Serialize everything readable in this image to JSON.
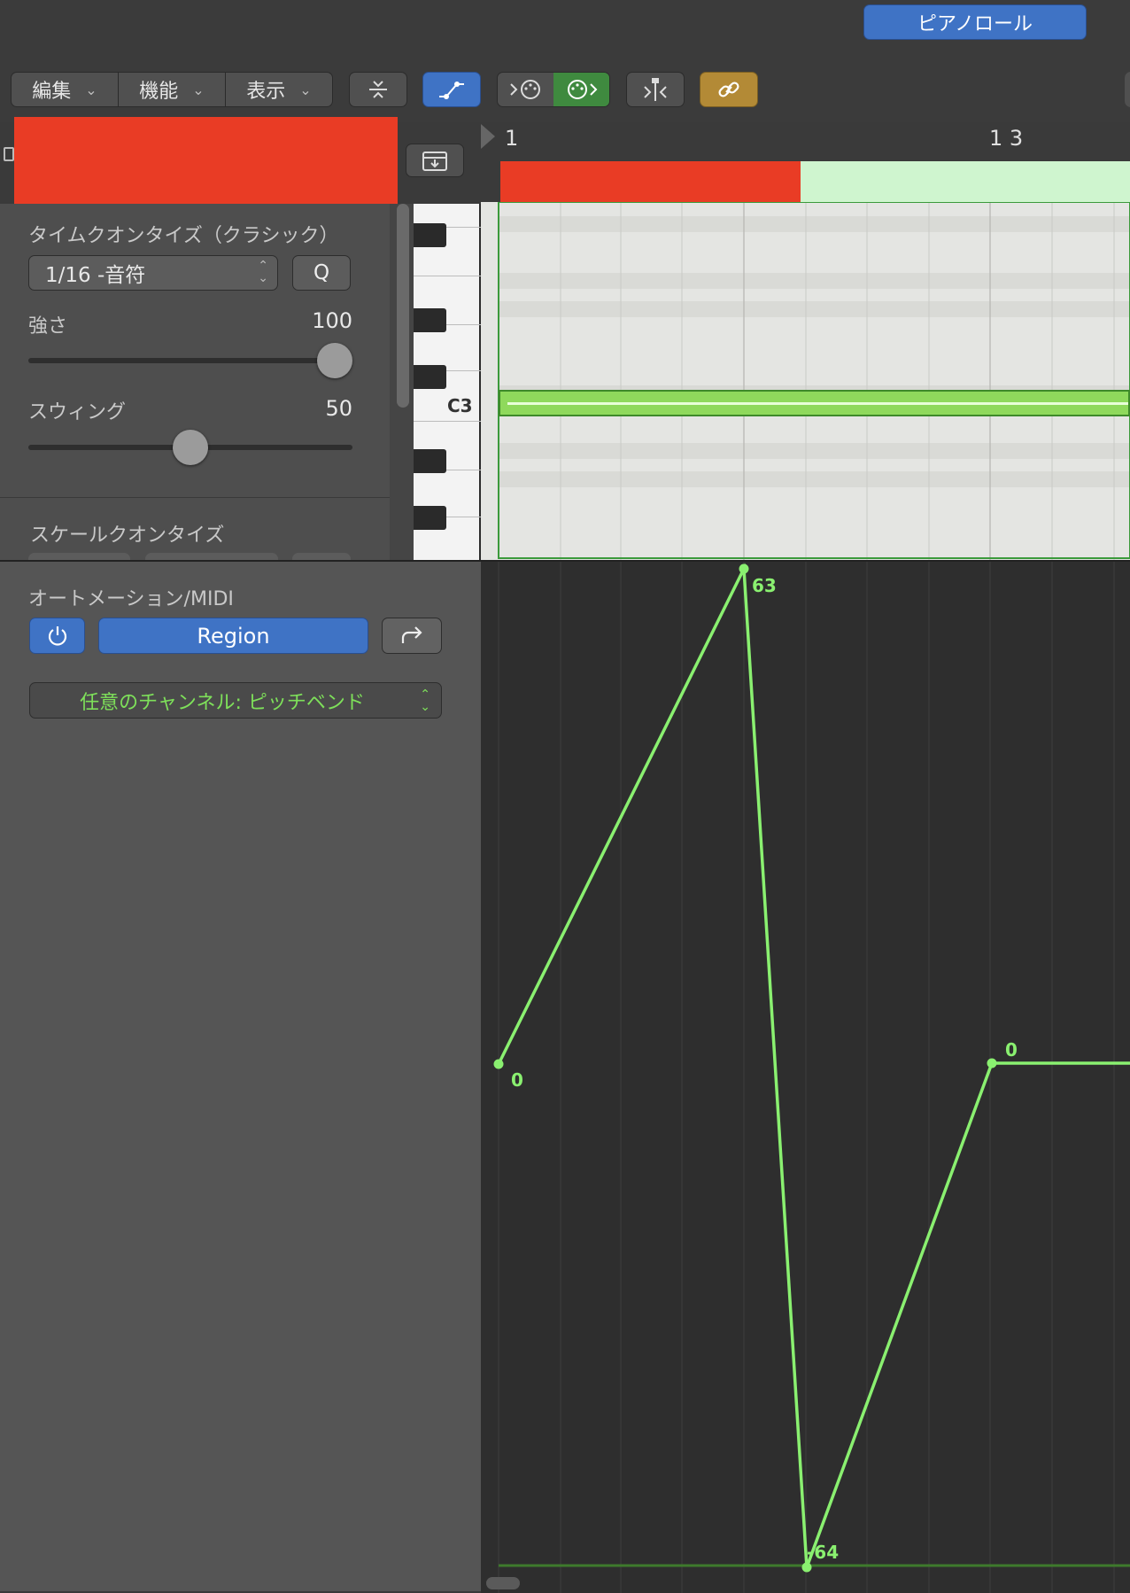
{
  "header": {
    "tab_label": "ピアノロール"
  },
  "toolbar": {
    "menus": [
      {
        "label": "編集"
      },
      {
        "label": "機能"
      },
      {
        "label": "表示"
      }
    ]
  },
  "colors": {
    "accent_blue": "#3f73c5",
    "region_red": "#e93c25",
    "green": "#8af070",
    "gold": "#b38a36"
  },
  "inspector": {
    "time_quantize_title": "タイムクオンタイズ（クラシック）",
    "quantize_value": "1/16 -音符",
    "q_button": "Q",
    "strength_label": "強さ",
    "strength_value": "100",
    "strength_level": 1.0,
    "swing_label": "スウィング",
    "swing_value": "50",
    "swing_level": 0.5,
    "scale_quantize_title": "スケールクオンタイズ"
  },
  "piano": {
    "c3_label": "C3"
  },
  "ruler": {
    "bar1": "1",
    "bar13": "1 3"
  },
  "automation": {
    "title": "オートメーション/MIDI",
    "mode_button": "Region",
    "channel_select": "任意のチャンネル: ピッチベンド",
    "points": [
      {
        "label": "0"
      },
      {
        "label": "63"
      },
      {
        "label": "-64"
      },
      {
        "label": "0"
      }
    ]
  }
}
